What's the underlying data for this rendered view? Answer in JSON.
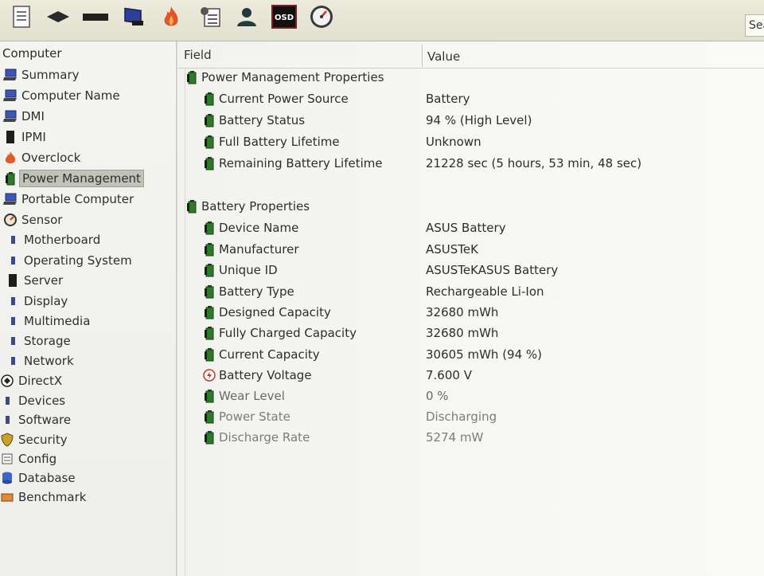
{
  "toolbar": {
    "icons": [
      "report-icon",
      "motherboard-icon",
      "memory-icon",
      "computer-icon",
      "overclock-icon",
      "checklist-icon",
      "user-icon",
      "osd-icon",
      "speedometer-icon"
    ],
    "osd_label": "OSD",
    "search_label": "Search"
  },
  "tree": {
    "header": "Computer",
    "items": [
      {
        "label": "Summary",
        "icon": "computer-icon"
      },
      {
        "label": "Computer Name",
        "icon": "computer-icon"
      },
      {
        "label": "DMI",
        "icon": "computer-icon"
      },
      {
        "label": "IPMI",
        "icon": "server-icon"
      },
      {
        "label": "Overclock",
        "icon": "fire-icon"
      },
      {
        "label": "Power Management",
        "icon": "battery-icon"
      },
      {
        "label": "Portable Computer",
        "icon": "laptop-icon"
      },
      {
        "label": "Sensor",
        "icon": "sensor-icon"
      },
      {
        "label": "Motherboard",
        "icon": "motherboard-icon"
      },
      {
        "label": "Operating System",
        "icon": "os-icon"
      },
      {
        "label": "Server",
        "icon": "server-icon"
      },
      {
        "label": "Display",
        "icon": "display-icon"
      },
      {
        "label": "Multimedia",
        "icon": "multimedia-icon"
      },
      {
        "label": "Storage",
        "icon": "storage-icon"
      },
      {
        "label": "Network",
        "icon": "network-icon"
      },
      {
        "label": "DirectX",
        "icon": "directx-icon"
      },
      {
        "label": "Devices",
        "icon": "devices-icon"
      },
      {
        "label": "Software",
        "icon": "software-icon"
      },
      {
        "label": "Security",
        "icon": "shield-icon"
      },
      {
        "label": "Config",
        "icon": "config-icon"
      },
      {
        "label": "Database",
        "icon": "database-icon"
      },
      {
        "label": "Benchmark",
        "icon": "benchmark-icon"
      }
    ]
  },
  "columns": {
    "field": "Field",
    "value": "Value"
  },
  "sections": [
    {
      "title": "Power Management Properties",
      "rows": [
        {
          "field": "Current Power Source",
          "value": "Battery"
        },
        {
          "field": "Battery Status",
          "value": "94 % (High Level)"
        },
        {
          "field": "Full Battery Lifetime",
          "value": "Unknown"
        },
        {
          "field": "Remaining Battery Lifetime",
          "value": "21228 sec (5 hours, 53 min, 48 sec)"
        }
      ]
    },
    {
      "title": "Battery Properties",
      "rows": [
        {
          "field": "Device Name",
          "value": "ASUS Battery"
        },
        {
          "field": "Manufacturer",
          "value": "ASUSTeK"
        },
        {
          "field": "Unique ID",
          "value": "ASUSTeKASUS Battery"
        },
        {
          "field": "Battery Type",
          "value": "Rechargeable Li-Ion"
        },
        {
          "field": "Designed Capacity",
          "value": "32680 mWh"
        },
        {
          "field": "Fully Charged Capacity",
          "value": "32680 mWh"
        },
        {
          "field": "Current Capacity",
          "value": "30605 mWh  (94 %)"
        },
        {
          "field": "Battery Voltage",
          "value": "7.600 V"
        },
        {
          "field": "Wear Level",
          "value": "0 %"
        },
        {
          "field": "Power State",
          "value": "Discharging"
        },
        {
          "field": "Discharge Rate",
          "value": "5274 mW"
        }
      ]
    }
  ]
}
